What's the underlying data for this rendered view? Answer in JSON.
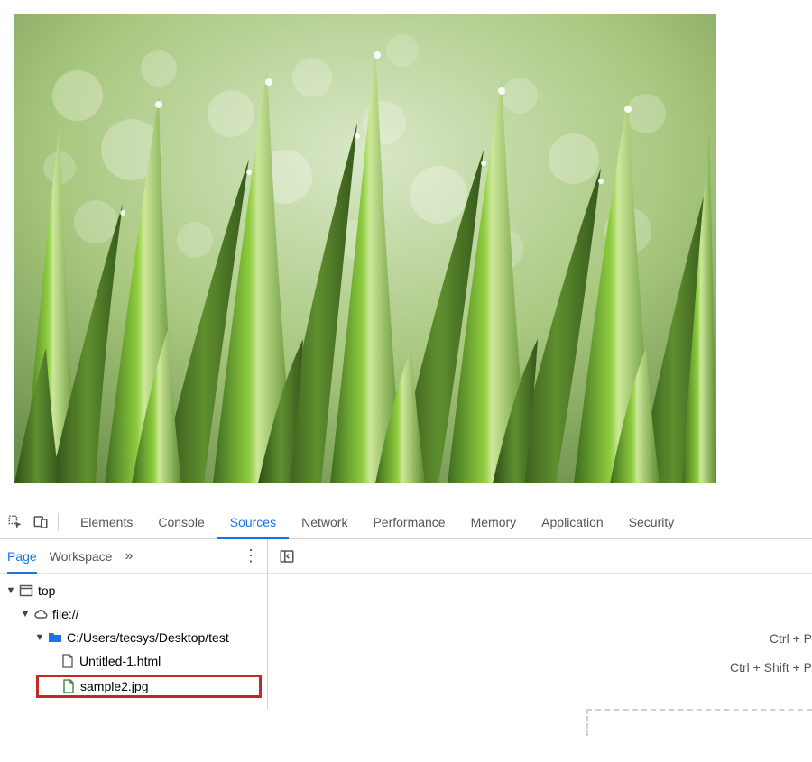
{
  "tabs": {
    "elements": "Elements",
    "console": "Console",
    "sources": "Sources",
    "network": "Network",
    "performance": "Performance",
    "memory": "Memory",
    "application": "Application",
    "security": "Security"
  },
  "subtabs": {
    "page": "Page",
    "workspace": "Workspace"
  },
  "tree": {
    "top": "top",
    "cloud": "file://",
    "folder": "C:/Users/tecsys/Desktop/test",
    "file_html": "Untitled-1.html",
    "file_img": "sample2.jpg"
  },
  "shortcuts": {
    "open": "Ctrl + P",
    "command": "Ctrl + Shift + P"
  }
}
